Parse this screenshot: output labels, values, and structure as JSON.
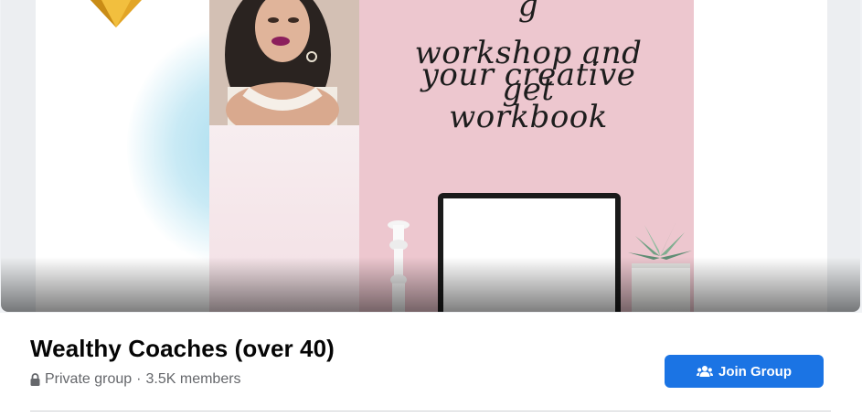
{
  "cover": {
    "image_text_lines": [
      "g",
      "workshop and get",
      "your creative",
      "workbook"
    ]
  },
  "group": {
    "name": "Wealthy Coaches (over 40)",
    "privacy": "Private group",
    "separator": "·",
    "members": "3.5K members"
  },
  "actions": {
    "join_label": "Join Group"
  },
  "colors": {
    "primary_button": "#1b74e4",
    "meta_text": "#65676b",
    "cover_pink": "#edc7cf"
  },
  "icons": {
    "privacy": "lock-icon",
    "join": "users-icon"
  }
}
